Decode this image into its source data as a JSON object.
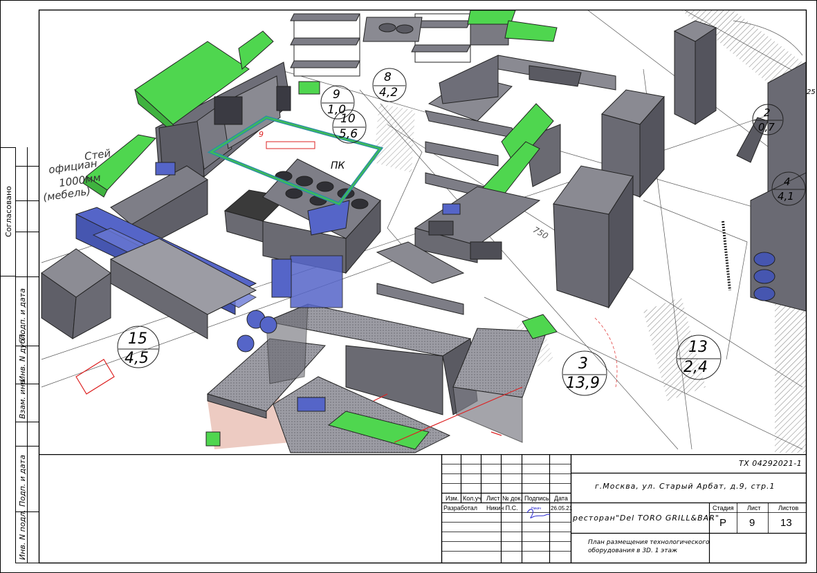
{
  "left_strip": {
    "approval_label": "Согласовано",
    "sign_date_1": "Подп. и дата",
    "dup_no": "Инв. N дубл.",
    "repl_inv": "Взам. инв.",
    "sign_date_2": "Подп. и дата",
    "orig_inv": "Инв. N подл."
  },
  "drawing": {
    "side_text": [
      "Стей",
      "официан",
      "1000мм",
      "(мебель)"
    ],
    "pk_label": "ПК",
    "marker_9": "9",
    "marker_25": "25",
    "marker_750": "750",
    "zones": [
      {
        "top": "8",
        "bottom": "4,2"
      },
      {
        "top": "9",
        "bottom": "1,0"
      },
      {
        "top": "10",
        "bottom": "5,6"
      },
      {
        "top": "15",
        "bottom": "4,5"
      },
      {
        "top": "3",
        "bottom": "13,9"
      },
      {
        "top": "13",
        "bottom": "2,4"
      },
      {
        "top": "2",
        "bottom": "0,7"
      },
      {
        "top": "4",
        "bottom": "4,1"
      }
    ]
  },
  "title_block": {
    "doc_code": "ТХ 04292021-1",
    "address": "г.Москва, ул. Старый Арбат, д.9, стр.1",
    "project": "ресторан\"Del TORO GRILL&BAR\"",
    "sheet_title_1": "План размещения технологического",
    "sheet_title_2": "оборудования в 3D. 1 этаж",
    "cols": {
      "izm": "Изм.",
      "kol": "Кол.уч",
      "list": "Лист",
      "doc": "№ док.",
      "sign": "Подпись",
      "date": "Дата"
    },
    "developed_label": "Разработал",
    "developer": "Никич П.С.",
    "signature": "Никич",
    "dev_date": "26.05.21",
    "stage_label": "Стадия",
    "sheet_label": "Лист",
    "sheets_label": "Листов",
    "stage": "Р",
    "sheet": "9",
    "sheets": "13"
  },
  "colors": {
    "hood": "#4fd64f",
    "shelf": "#5565c8",
    "steel": "#6e6e78",
    "table": "#9a9aa2",
    "red": "#d81e1e"
  }
}
